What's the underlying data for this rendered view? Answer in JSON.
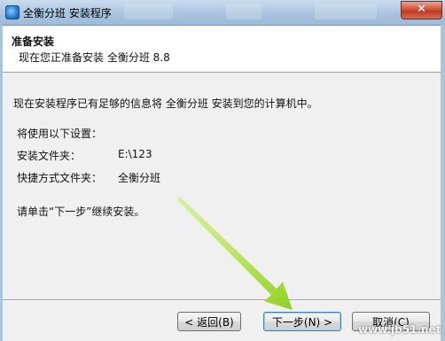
{
  "window": {
    "title": "全衡分班 安装程序",
    "close_glyph": "✕",
    "icon": "installer-app-icon"
  },
  "header": {
    "title": "准备安装",
    "subtitle": "现在您正准备安装 全衡分班 8.8"
  },
  "body": {
    "intro": "现在安装程序已有足够的信息将 全衡分班 安装到您的计算机中。",
    "settings_label": "将使用以下设置：",
    "folder_label": "安装文件夹：",
    "folder_value": "E:\\123",
    "shortcut_label": "快捷方式文件夹：",
    "shortcut_value": "全衡分班",
    "continue_hint": "请单击“下一步”继续安装。"
  },
  "buttons": {
    "back": "< 返回(B)",
    "next": "下一步(N) >",
    "cancel": "取消(C)"
  },
  "colors": {
    "arrow": "#8fd11f",
    "titlebar": "#a9c4df",
    "close": "#c0381f"
  },
  "watermark": "www.jb51.net"
}
